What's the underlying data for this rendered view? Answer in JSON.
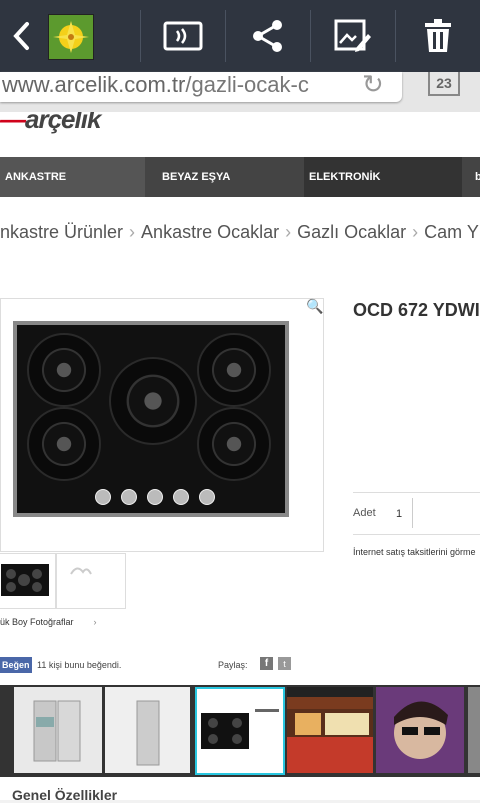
{
  "toolbar": {
    "back_icon": "back-chevron-icon",
    "app_thumb_icon": "gallery-thumbnail-icon",
    "cast_icon": "screen-mirroring-icon",
    "share_icon": "share-icon",
    "edit_icon": "edit-image-icon",
    "delete_icon": "trash-icon"
  },
  "browser": {
    "url_host": "www.arcelik.com.tr",
    "url_path": "/gazli-ocak-c",
    "tab_count": "23"
  },
  "site": {
    "logo": "arçelik",
    "nav": [
      "ANKASTRE",
      "BEYAZ EŞYA",
      "ELEKTRONİK",
      "b"
    ],
    "breadcrumbs": [
      "nkastre Ürünler",
      "Ankastre Ocaklar",
      "Gazlı Ocaklar",
      "Cam Yüz"
    ],
    "product_title": "OCD 672 YDWI",
    "qty_label": "Adet",
    "qty_value": "1",
    "installment_text": "İnternet satış taksitlerini görme",
    "big_photos_label": "ük Boy Fotoğraflar",
    "like_label": "Beğen",
    "like_count_text": "11 kişi bunu beğendi.",
    "share_label": "Paylaş:",
    "section_title": "Genel Özellikler"
  },
  "colors": {
    "toolbar_bg": "#2f3540",
    "nav_bg": "#444444",
    "brand_red": "#d0021b",
    "link_blue": "#2a7fd8"
  }
}
